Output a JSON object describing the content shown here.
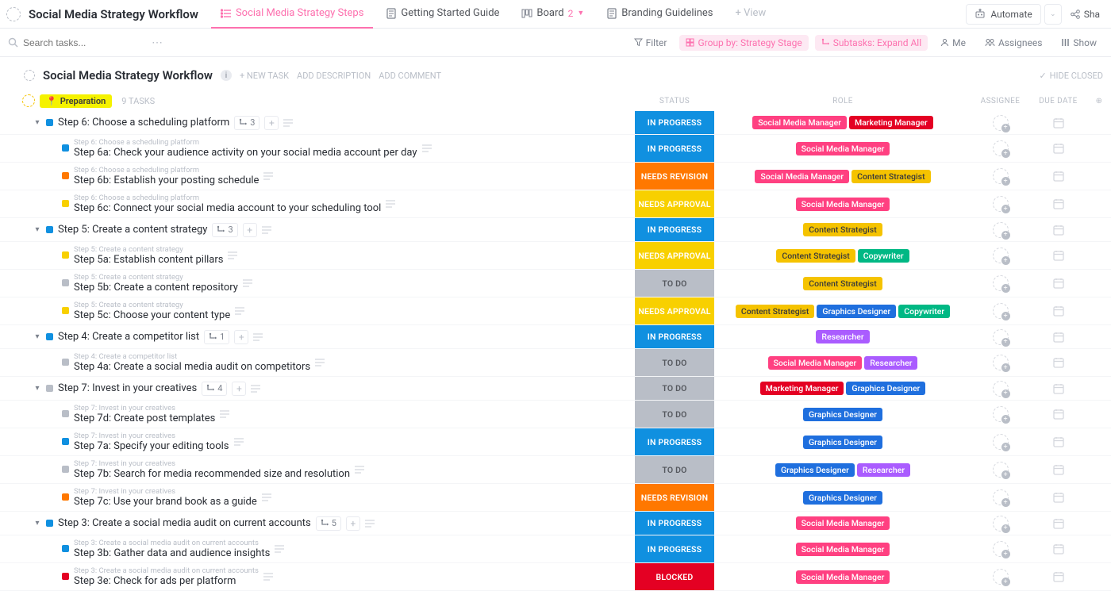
{
  "mainTitle": "Social Media Strategy Workflow",
  "tabs": {
    "active": "Social Media Strategy Steps",
    "t1": "Getting Started Guide",
    "t2": "Board",
    "t2badge": "2",
    "t3": "Branding Guidelines",
    "addView": "+ View",
    "automate": "Automate",
    "share": "Sha"
  },
  "filter": {
    "searchPlaceholder": "Search tasks...",
    "filter": "Filter",
    "groupBy": "Group by: Strategy Stage",
    "subtasks": "Subtasks: Expand All",
    "me": "Me",
    "assignees": "Assignees",
    "show": "Show"
  },
  "listHeader": {
    "title": "Social Media Strategy Workflow",
    "newTask": "+ NEW TASK",
    "addDesc": "ADD DESCRIPTION",
    "addComment": "ADD COMMENT",
    "hideClosed": "HIDE CLOSED"
  },
  "group": {
    "name": "Preparation",
    "count": "9 TASKS"
  },
  "cols": {
    "status": "STATUS",
    "role": "ROLE",
    "assignee": "ASSIGNEE",
    "due": "DUE DATE"
  },
  "statusColors": {
    "IN PROGRESS": "#1090e0",
    "NEEDS REVISION": "#ff7800",
    "NEEDS APPROVAL": "#f8d000",
    "TO DO": "#b9bec7",
    "BLOCKED": "#e40023"
  },
  "roleColors": {
    "Social Media Manager": "#ff4081",
    "Marketing Manager": "#e40023",
    "Content Strategist": "#f5c300",
    "Copywriter": "#00b884",
    "Graphics Designer": "#1f6fde",
    "Researcher": "#aa5cff"
  },
  "tasks": [
    {
      "level": 0,
      "name": "Step 6: Choose a scheduling platform",
      "sq": "#1090e0",
      "subcount": "3",
      "status": "IN PROGRESS",
      "roles": [
        "Social Media Manager",
        "Marketing Manager"
      ]
    },
    {
      "level": 1,
      "parent": "Step 6: Choose a scheduling platform",
      "name": "Step 6a: Check your audience activity on your social media account per day",
      "sq": "#1090e0",
      "status": "IN PROGRESS",
      "roles": [
        "Social Media Manager"
      ]
    },
    {
      "level": 1,
      "parent": "Step 6: Choose a scheduling platform",
      "name": "Step 6b: Establish your posting schedule",
      "sq": "#ff7800",
      "status": "NEEDS REVISION",
      "roles": [
        "Social Media Manager",
        "Content Strategist"
      ]
    },
    {
      "level": 1,
      "parent": "Step 6: Choose a scheduling platform",
      "name": "Step 6c: Connect your social media account to your scheduling tool",
      "sq": "#f8d000",
      "status": "NEEDS APPROVAL",
      "roles": [
        "Social Media Manager"
      ]
    },
    {
      "level": 0,
      "name": "Step 5: Create a content strategy",
      "sq": "#1090e0",
      "subcount": "3",
      "status": "IN PROGRESS",
      "roles": [
        "Content Strategist"
      ]
    },
    {
      "level": 1,
      "parent": "Step 5: Create a content strategy",
      "name": "Step 5a: Establish content pillars",
      "sq": "#f8d000",
      "status": "NEEDS APPROVAL",
      "roles": [
        "Content Strategist",
        "Copywriter"
      ]
    },
    {
      "level": 1,
      "parent": "Step 5: Create a content strategy",
      "name": "Step 5b: Create a content repository",
      "sq": "#b9bec7",
      "status": "TO DO",
      "roles": [
        "Content Strategist"
      ]
    },
    {
      "level": 1,
      "parent": "Step 5: Create a content strategy",
      "name": "Step 5c: Choose your content type",
      "sq": "#f8d000",
      "status": "NEEDS APPROVAL",
      "roles": [
        "Content Strategist",
        "Graphics Designer",
        "Copywriter"
      ]
    },
    {
      "level": 0,
      "name": "Step 4: Create a competitor list",
      "sq": "#1090e0",
      "subcount": "1",
      "status": "IN PROGRESS",
      "roles": [
        "Researcher"
      ]
    },
    {
      "level": 1,
      "parent": "Step 4: Create a competitor list",
      "name": "Step 4a: Create a social media audit on competitors",
      "sq": "#b9bec7",
      "status": "TO DO",
      "roles": [
        "Social Media Manager",
        "Researcher"
      ]
    },
    {
      "level": 0,
      "name": "Step 7: Invest in your creatives",
      "sq": "#b9bec7",
      "subcount": "4",
      "status": "TO DO",
      "roles": [
        "Marketing Manager",
        "Graphics Designer"
      ]
    },
    {
      "level": 1,
      "parent": "Step 7: Invest in your creatives",
      "name": "Step 7d: Create post templates",
      "sq": "#b9bec7",
      "status": "TO DO",
      "roles": [
        "Graphics Designer"
      ]
    },
    {
      "level": 1,
      "parent": "Step 7: Invest in your creatives",
      "name": "Step 7a: Specify your editing tools",
      "sq": "#1090e0",
      "status": "IN PROGRESS",
      "roles": [
        "Graphics Designer"
      ]
    },
    {
      "level": 1,
      "parent": "Step 7: Invest in your creatives",
      "name": "Step 7b: Search for media recommended size and resolution",
      "sq": "#b9bec7",
      "status": "TO DO",
      "roles": [
        "Graphics Designer",
        "Researcher"
      ]
    },
    {
      "level": 1,
      "parent": "Step 7: Invest in your creatives",
      "name": "Step 7c: Use your brand book as a guide",
      "sq": "#ff7800",
      "status": "NEEDS REVISION",
      "roles": [
        "Graphics Designer"
      ]
    },
    {
      "level": 0,
      "name": "Step 3: Create a social media audit on current accounts",
      "sq": "#1090e0",
      "subcount": "5",
      "status": "IN PROGRESS",
      "roles": [
        "Social Media Manager"
      ]
    },
    {
      "level": 1,
      "parent": "Step 3: Create a social media audit on current accounts",
      "name": "Step 3b: Gather data and audience insights",
      "sq": "#1090e0",
      "status": "IN PROGRESS",
      "roles": [
        "Social Media Manager"
      ]
    },
    {
      "level": 1,
      "parent": "Step 3: Create a social media audit on current accounts",
      "name": "Step 3e: Check for ads per platform",
      "sq": "#e40023",
      "status": "BLOCKED",
      "roles": [
        "Social Media Manager"
      ]
    }
  ]
}
